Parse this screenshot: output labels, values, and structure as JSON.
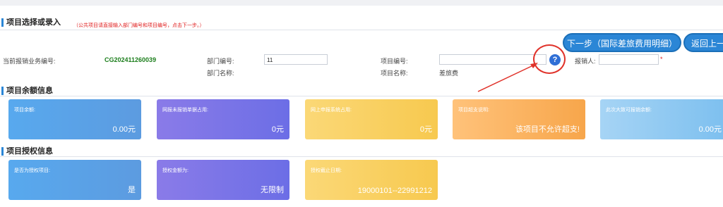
{
  "section1": {
    "title": "项目选择或录入",
    "hint": "（公共项目请直接输入部门编号和项目编号，点击下一步。）"
  },
  "buttons": {
    "next": "下一步（国际差旅费用明细）",
    "back": "返回上一"
  },
  "form": {
    "biz_no_label": "当前报销业务编号:",
    "biz_no_value": "CG202411260039",
    "dept_no_label": "部门编号:",
    "dept_no_value": "11",
    "dept_name_label": "部门名称:",
    "proj_no_label": "项目编号:",
    "proj_no_value": "",
    "proj_name_label": "项目名称:",
    "proj_name_value": "差旅费",
    "reimburser_label": "报销人:",
    "reimburser_value": "",
    "required_mark": "*",
    "help_icon": "?"
  },
  "section2": {
    "title": "项目余额信息",
    "cards": [
      {
        "title": "项目余额:",
        "value": "0.00元",
        "color": "#58a9ee"
      },
      {
        "title": "网报未报销单据占用:",
        "value": "0元",
        "color": "#8a7be8"
      },
      {
        "title": "网上申报系统占用:",
        "value": "0元",
        "color": "#fbd877"
      },
      {
        "title": "项目超支说明:",
        "value": "该项目不允许超支!",
        "color": "#ffc27a"
      },
      {
        "title": "此次大致可报销余额:",
        "value": "0.00元",
        "color": "#a6d4f5"
      }
    ]
  },
  "section3": {
    "title": "项目授权信息",
    "cards": [
      {
        "title": "是否为授权项目:",
        "value": "是",
        "color": "#58a9ee"
      },
      {
        "title": "授权金额为:",
        "value": "无限制",
        "color": "#8a7be8"
      },
      {
        "title": "授权截止日期:",
        "value": "19000101--22991212",
        "color": "#fbd877"
      }
    ]
  }
}
